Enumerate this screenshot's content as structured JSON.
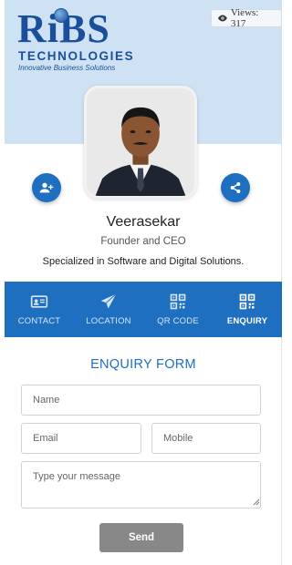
{
  "header": {
    "logo": {
      "main": "RiBS",
      "sub": "TECHNOLOGIES",
      "tagline": "Innovative Business Solutions"
    },
    "views_text": "Views: 317"
  },
  "profile": {
    "name": "Veerasekar",
    "title": "Founder and CEO",
    "tagline": "Specialized in Software and Digital Solutions."
  },
  "actions": {
    "add_contact_icon": "user-plus-icon",
    "share_icon": "share-icon"
  },
  "tabs": [
    {
      "label": "CONTACT",
      "icon": "id-card-icon",
      "active": false
    },
    {
      "label": "LOCATION",
      "icon": "paper-plane-icon",
      "active": false
    },
    {
      "label": "QR CODE",
      "icon": "qr-code-icon",
      "active": false
    },
    {
      "label": "ENQUIRY",
      "icon": "qr-code-icon",
      "active": true
    }
  ],
  "enquiry_form": {
    "title": "ENQUIRY FORM",
    "name_placeholder": "Name",
    "email_placeholder": "Email",
    "mobile_placeholder": "Mobile",
    "message_placeholder": "Type your message",
    "send_label": "Send"
  },
  "colors": {
    "accent": "#1f6fc0",
    "banner": "#cfe2f3",
    "send_button": "#888888"
  }
}
